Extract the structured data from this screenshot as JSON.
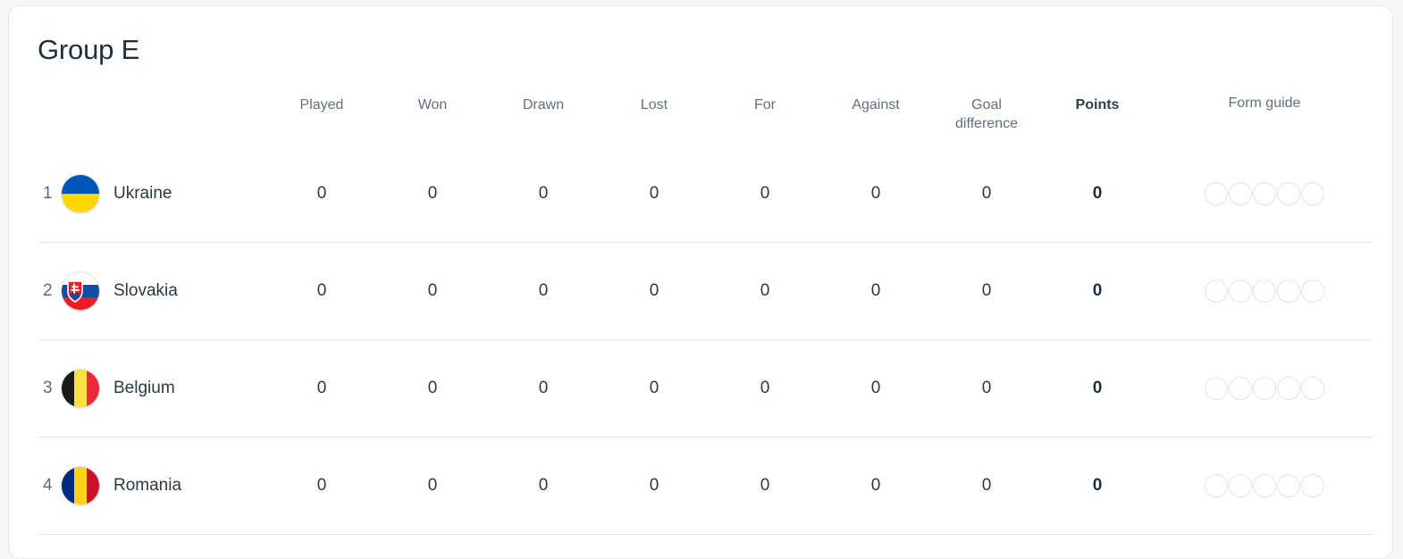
{
  "card": {
    "title": "Group E"
  },
  "table": {
    "columns": [
      {
        "key": "team",
        "label": ""
      },
      {
        "key": "played",
        "label": "Played"
      },
      {
        "key": "won",
        "label": "Won"
      },
      {
        "key": "drawn",
        "label": "Drawn"
      },
      {
        "key": "lost",
        "label": "Lost"
      },
      {
        "key": "for",
        "label": "For"
      },
      {
        "key": "against",
        "label": "Against"
      },
      {
        "key": "goal_difference",
        "label": "Goal difference"
      },
      {
        "key": "points",
        "label": "Points"
      },
      {
        "key": "form_guide",
        "label": "Form guide"
      }
    ],
    "headers": {
      "played": "Played",
      "won": "Won",
      "drawn": "Drawn",
      "lost": "Lost",
      "for": "For",
      "against": "Against",
      "goal_difference_line1": "Goal",
      "goal_difference_line2": "difference",
      "points": "Points",
      "form_guide": "Form guide"
    },
    "rows": [
      {
        "rank": "1",
        "team": "Ukraine",
        "flag": "flag-ukraine",
        "played": "0",
        "won": "0",
        "drawn": "0",
        "lost": "0",
        "for": "0",
        "against": "0",
        "goal_difference": "0",
        "points": "0",
        "form_guide": [
          "",
          "",
          "",
          "",
          ""
        ]
      },
      {
        "rank": "2",
        "team": "Slovakia",
        "flag": "flag-slovakia",
        "played": "0",
        "won": "0",
        "drawn": "0",
        "lost": "0",
        "for": "0",
        "against": "0",
        "goal_difference": "0",
        "points": "0",
        "form_guide": [
          "",
          "",
          "",
          "",
          ""
        ]
      },
      {
        "rank": "3",
        "team": "Belgium",
        "flag": "flag-belgium",
        "played": "0",
        "won": "0",
        "drawn": "0",
        "lost": "0",
        "for": "0",
        "against": "0",
        "goal_difference": "0",
        "points": "0",
        "form_guide": [
          "",
          "",
          "",
          "",
          ""
        ]
      },
      {
        "rank": "4",
        "team": "Romania",
        "flag": "flag-romania",
        "played": "0",
        "won": "0",
        "drawn": "0",
        "lost": "0",
        "for": "0",
        "against": "0",
        "goal_difference": "0",
        "points": "0",
        "form_guide": [
          "",
          "",
          "",
          "",
          ""
        ]
      }
    ]
  },
  "colors": {
    "title_text": "#1d3042",
    "header_text": "#5f7080",
    "body_text": "#293945",
    "divider": "#e6e6ea",
    "card_border": "#e8e8ec",
    "page_background": "#f6f6f8",
    "form_circle_border": "#e3e3e7",
    "ukraine_blue": "#0057b7",
    "ukraine_yellow": "#ffd700",
    "slovakia_blue": "#0b4ea2",
    "slovakia_red": "#ee1c25",
    "belgium_black": "#1a1a1a",
    "belgium_yellow": "#fae042",
    "belgium_red": "#ed2939",
    "romania_blue": "#002b7f",
    "romania_yellow": "#fcd116",
    "romania_red": "#ce1126"
  }
}
